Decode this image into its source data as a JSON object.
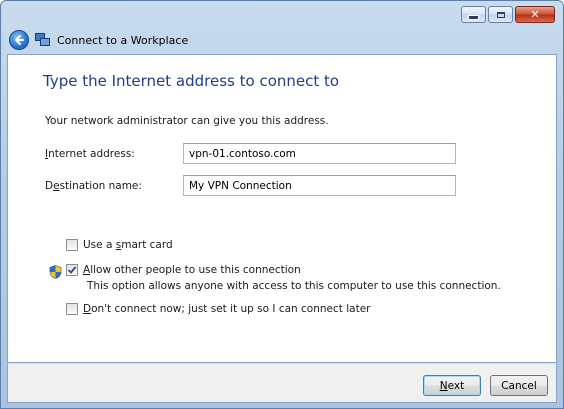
{
  "window": {
    "title": "Connect to a Workplace",
    "caption_buttons": {
      "minimize": "–",
      "maximize": "□",
      "close": "✕"
    }
  },
  "page": {
    "instruction": "Type the Internet address to connect to",
    "description": "Your network administrator can give you this address."
  },
  "fields": {
    "internet_address": {
      "label_accel": "I",
      "label_rest": "nternet address:",
      "value": "vpn-01.contoso.com"
    },
    "destination_name": {
      "label_pre": "D",
      "label_accel": "e",
      "label_rest": "stination name:",
      "value": "My VPN Connection"
    }
  },
  "options": {
    "smart_card": {
      "label_pre": "Use a ",
      "label_accel": "s",
      "label_rest": "mart card",
      "checked": false
    },
    "allow_others": {
      "label_accel": "A",
      "label_rest": "llow other people to use this connection",
      "checked": true,
      "detail": "This option allows anyone with access to this computer to use this connection."
    },
    "dont_connect": {
      "label_accel": "D",
      "label_rest": "on't connect now; just set it up so I can connect later",
      "checked": false
    }
  },
  "buttons": {
    "next": {
      "accel": "N",
      "rest": "ext"
    },
    "cancel": "Cancel"
  },
  "icons": {
    "back": "back-arrow-icon",
    "wizard": "network-wizard-icon",
    "shield": "uac-shield-icon"
  },
  "colors": {
    "instruction_text": "#1e3f87",
    "close_button": "#c9432a",
    "titlebar": "#b5cde6"
  }
}
